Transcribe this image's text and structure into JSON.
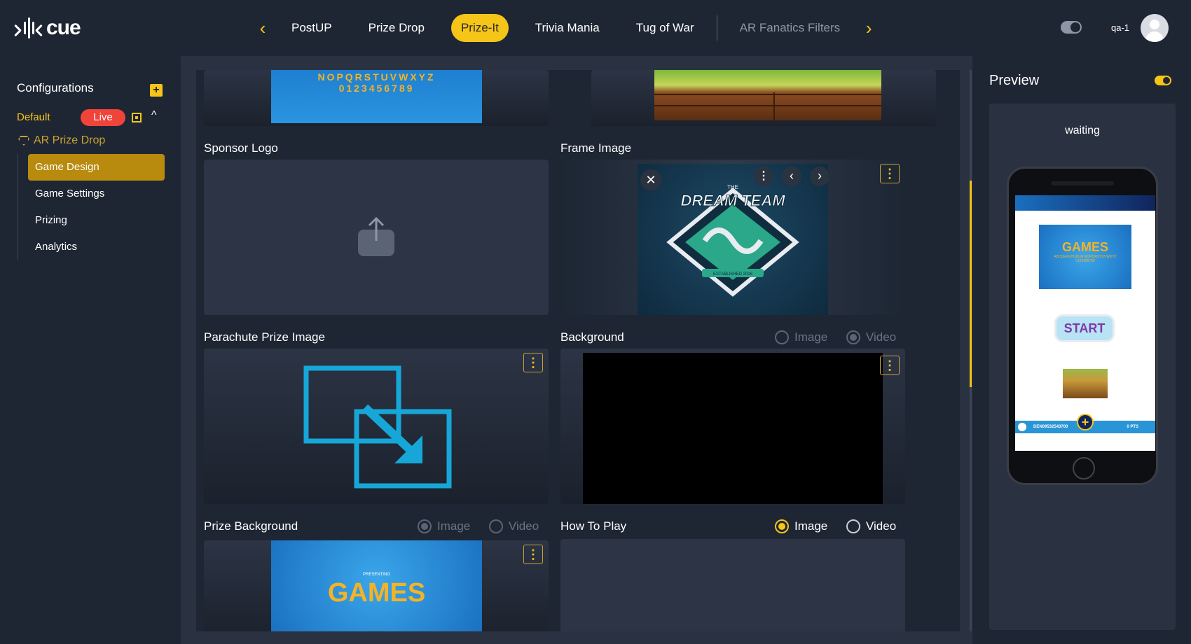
{
  "app": {
    "logo_text": "cue"
  },
  "nav": {
    "prev": "‹",
    "next": "›",
    "tabs": [
      "PostUP",
      "Prize Drop",
      "Prize-It",
      "Trivia Mania",
      "Tug of War"
    ],
    "active_tab": "Prize-It",
    "extra_tab": "AR Fanatics Filters"
  },
  "user": {
    "name": "qa-1"
  },
  "sidebar": {
    "title": "Configurations",
    "add": "+",
    "config_name": "Default",
    "live_badge": "Live",
    "game_name": "AR Prize Drop",
    "items": [
      {
        "label": "Game Design",
        "active": true
      },
      {
        "label": "Game Settings",
        "active": false
      },
      {
        "label": "Prizing",
        "active": false
      },
      {
        "label": "Analytics",
        "active": false
      }
    ]
  },
  "cards": {
    "top_left_text": "NOPQRSTUVWXYZ",
    "top_left_text2": "0123456789",
    "sponsor_logo": "Sponsor Logo",
    "frame_image": "Frame Image",
    "frame_logo_small": "THE",
    "frame_logo_text": "DREAM TEAM",
    "frame_logo_sub": "ESTABLISHED 2016",
    "parachute": "Parachute Prize Image",
    "background": "Background",
    "prize_background": "Prize Background",
    "prize_bg_small": "PRESENTING",
    "prize_bg_text": "GAMES",
    "how_to_play": "How To Play",
    "radio_image": "Image",
    "radio_video": "Video",
    "kebab": "⋮"
  },
  "preview": {
    "title": "Preview",
    "status": "waiting",
    "games_text": "GAMES",
    "games_sub": "ABCDEFGHIJKLM NOPQRSTUVWXYZ 0123456789",
    "start_text": "START",
    "footer_id": "DEN09532543700",
    "footer_pts": "0 PTS"
  },
  "colors": {
    "accent": "#f5c518",
    "live": "#f0443a",
    "panel": "#2a3242",
    "bg": "#1f2633"
  }
}
